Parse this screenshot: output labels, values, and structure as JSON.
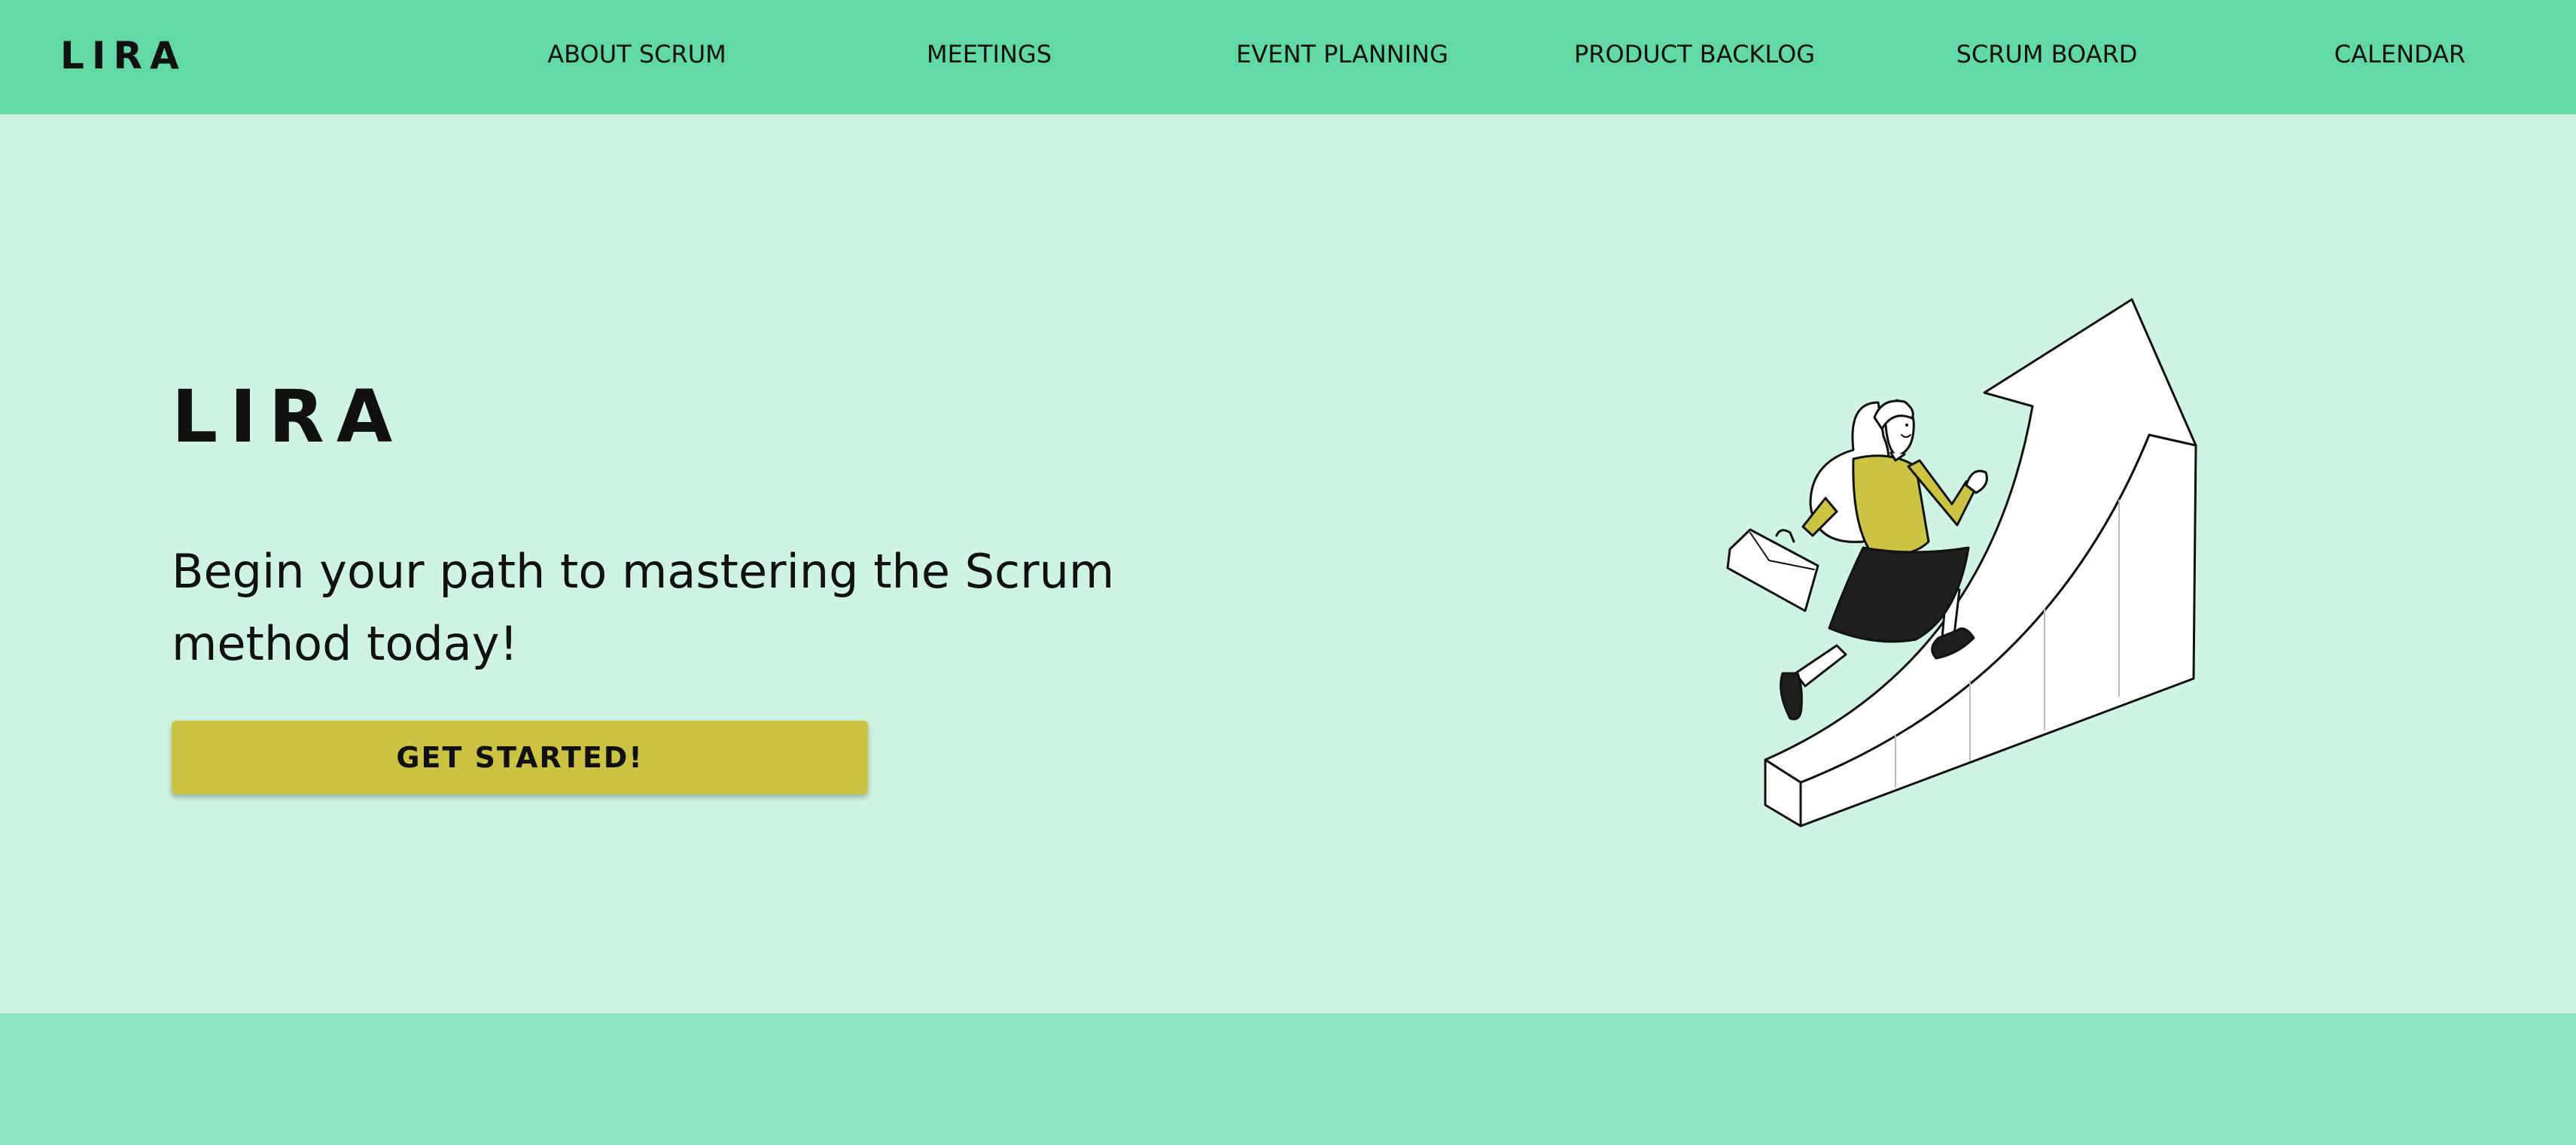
{
  "brand": {
    "name": "LIRA"
  },
  "nav": {
    "items": [
      {
        "label": "ABOUT SCRUM"
      },
      {
        "label": "MEETINGS"
      },
      {
        "label": "EVENT PLANNING"
      },
      {
        "label": "PRODUCT BACKLOG"
      },
      {
        "label": "SCRUM BOARD"
      },
      {
        "label": "CALENDAR"
      }
    ]
  },
  "hero": {
    "title": "LIRA",
    "subtitle": "Begin your path to mastering the Scrum method today!",
    "cta_label": "GET STARTED!",
    "illustration": "woman-climbing-growth-arrow"
  },
  "colors": {
    "nav_background": "#62d8a4",
    "page_background": "#cff4e3",
    "button": "#cbc442",
    "footer_band": "#91e4c1",
    "text": "#111111"
  }
}
